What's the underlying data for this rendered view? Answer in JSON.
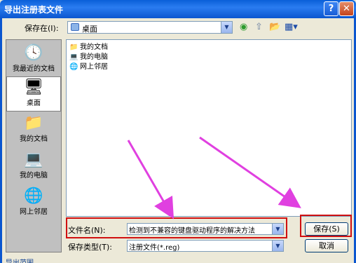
{
  "window": {
    "title": "导出注册表文件",
    "help_glyph": "?",
    "close_glyph": "✕"
  },
  "toolbar": {
    "save_in_label": "保存在(I):",
    "save_in_value": "桌面",
    "back_glyph": "◉",
    "up_glyph": "⇧",
    "newfolder_glyph": "📂",
    "views_glyph": "▦▾"
  },
  "places": [
    {
      "label": "我最近的文档",
      "icon": "recent-docs-icon",
      "glyph": "🕓"
    },
    {
      "label": "桌面",
      "icon": "desktop-icon",
      "glyph": "🖥"
    },
    {
      "label": "我的文档",
      "icon": "my-documents-icon",
      "glyph": "📁"
    },
    {
      "label": "我的电脑",
      "icon": "my-computer-icon",
      "glyph": "💻"
    },
    {
      "label": "网上邻居",
      "icon": "network-icon",
      "glyph": "🌐"
    }
  ],
  "files": [
    {
      "name": "我的文档",
      "icon": "folder-icon",
      "glyph": "📁"
    },
    {
      "name": "我的电脑",
      "icon": "computer-icon",
      "glyph": "💻"
    },
    {
      "name": "网上邻居",
      "icon": "network-icon",
      "glyph": "🌐"
    }
  ],
  "filename": {
    "label": "文件名(N):",
    "value": "检测到不兼容的键盘驱动程序的解决方法"
  },
  "filetype": {
    "label": "保存类型(T):",
    "value": "注册文件(*.reg)"
  },
  "buttons": {
    "save": "保存(S)",
    "cancel": "取消"
  },
  "export_range_label": "导出范围",
  "colors": {
    "titlebar": "#0b56cf",
    "highlight_box": "#d01010",
    "arrow": "#e040e0"
  }
}
